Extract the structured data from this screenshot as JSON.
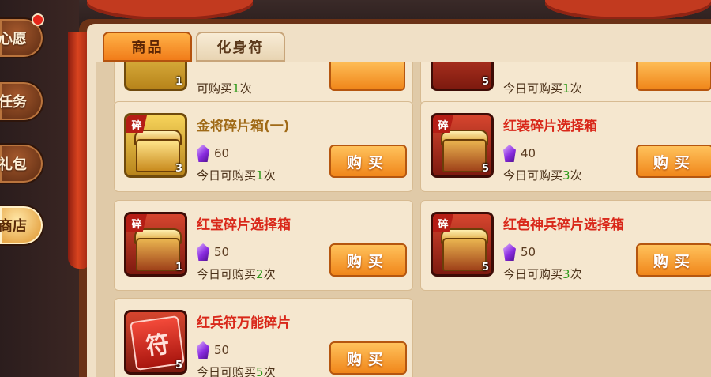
{
  "sidebar": {
    "items": [
      {
        "label": "心愿",
        "has_red_dot": true
      },
      {
        "label": "任务"
      },
      {
        "label": "礼包"
      },
      {
        "label": "商店",
        "active": true
      }
    ]
  },
  "tabs": [
    {
      "label": "商品",
      "active": true
    },
    {
      "label": "化身符",
      "active": false
    }
  ],
  "partial_top_row": [
    {
      "qty": "1",
      "limit_prefix": "可购买",
      "limit_count": "1",
      "limit_suffix": "次"
    },
    {
      "qty": "5",
      "limit_prefix": "今日可购买",
      "limit_count": "1",
      "limit_suffix": "次"
    }
  ],
  "items": [
    {
      "name": "金将碎片箱(一)",
      "name_color": "gold",
      "fragment_badge": "碎",
      "qty": "3",
      "price": "60",
      "limit_prefix": "今日可购买",
      "limit_count": "1",
      "limit_suffix": "次",
      "buy_label": "购买",
      "icon": "gold-chest-icon"
    },
    {
      "name": "红装碎片选择箱",
      "name_color": "red",
      "fragment_badge": "碎",
      "qty": "5",
      "price": "40",
      "limit_prefix": "今日可购买",
      "limit_count": "3",
      "limit_suffix": "次",
      "buy_label": "购买",
      "icon": "red-chest-icon"
    },
    {
      "name": "红宝碎片选择箱",
      "name_color": "red",
      "fragment_badge": "碎",
      "qty": "1",
      "price": "50",
      "limit_prefix": "今日可购买",
      "limit_count": "2",
      "limit_suffix": "次",
      "buy_label": "购买",
      "icon": "red-chest-icon"
    },
    {
      "name": "红色神兵碎片选择箱",
      "name_color": "red",
      "fragment_badge": "碎",
      "qty": "5",
      "price": "50",
      "limit_prefix": "今日可购买",
      "limit_count": "3",
      "limit_suffix": "次",
      "buy_label": "购买",
      "icon": "red-chest-icon"
    },
    {
      "name": "红兵符万能碎片",
      "name_color": "red",
      "qty": "5",
      "price": "50",
      "limit_prefix": "今日可购买",
      "limit_count": "5",
      "limit_suffix": "次",
      "buy_label": "购买",
      "icon": "talisman-icon",
      "talisman_glyph": "符"
    }
  ],
  "currency_icon": "purple-gem-icon",
  "colors": {
    "tab_active": "#f17c19",
    "name_gold": "#a06a17",
    "name_red": "#d9281a",
    "limit_count": "#2f9a1b",
    "buy_button": "#f0861a"
  }
}
